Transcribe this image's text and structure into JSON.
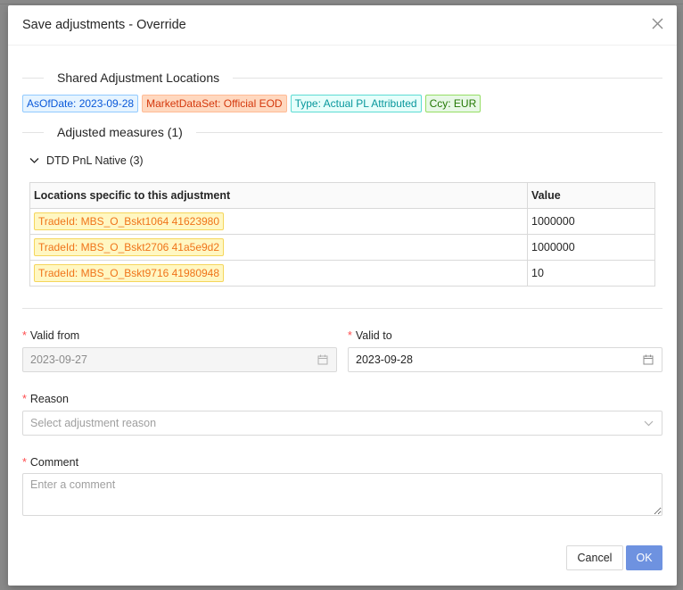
{
  "modal": {
    "title": "Save adjustments - Override"
  },
  "shared_section": {
    "title": "Shared Adjustment Locations",
    "tags": [
      {
        "label": "AsOfDate: 2023-09-28",
        "bg": "#e6f4ff",
        "border": "#91caff",
        "color": "#0958d9"
      },
      {
        "label": "MarketDataSet: Official EOD",
        "bg": "#ffd8bf",
        "border": "#ffbb96",
        "color": "#d4380d"
      },
      {
        "label": "Type: Actual PL Attributed",
        "bg": "#e6fffb",
        "border": "#5cdbd3",
        "color": "#08979c"
      },
      {
        "label": "Ccy: EUR",
        "bg": "#e8f8e6",
        "border": "#95de64",
        "color": "#237804"
      }
    ]
  },
  "measures_section": {
    "title": "Adjusted measures (1)",
    "group_label": "DTD PnL Native (3)",
    "table": {
      "headers": [
        "Locations specific to this adjustment",
        "Value"
      ],
      "rows": [
        {
          "location": "TradeId: MBS_O_Bskt1064 41623980",
          "value": "1000000"
        },
        {
          "location": "TradeId: MBS_O_Bskt2706 41a5e9d2",
          "value": "1000000"
        },
        {
          "location": "TradeId: MBS_O_Bskt9716 41980948",
          "value": "10"
        }
      ]
    }
  },
  "form": {
    "required_mark": "*",
    "valid_from": {
      "label": "Valid from",
      "value": "2023-09-27"
    },
    "valid_to": {
      "label": "Valid to",
      "value": "2023-09-28"
    },
    "reason": {
      "label": "Reason",
      "placeholder": "Select adjustment reason"
    },
    "comment": {
      "label": "Comment",
      "placeholder": "Enter a comment"
    }
  },
  "footer": {
    "cancel_label": "Cancel",
    "ok_label": "OK"
  },
  "icons": {
    "close": "close-icon",
    "collapse": "chevron-down-icon",
    "calendar": "calendar-icon",
    "select": "chevron-down-icon"
  }
}
